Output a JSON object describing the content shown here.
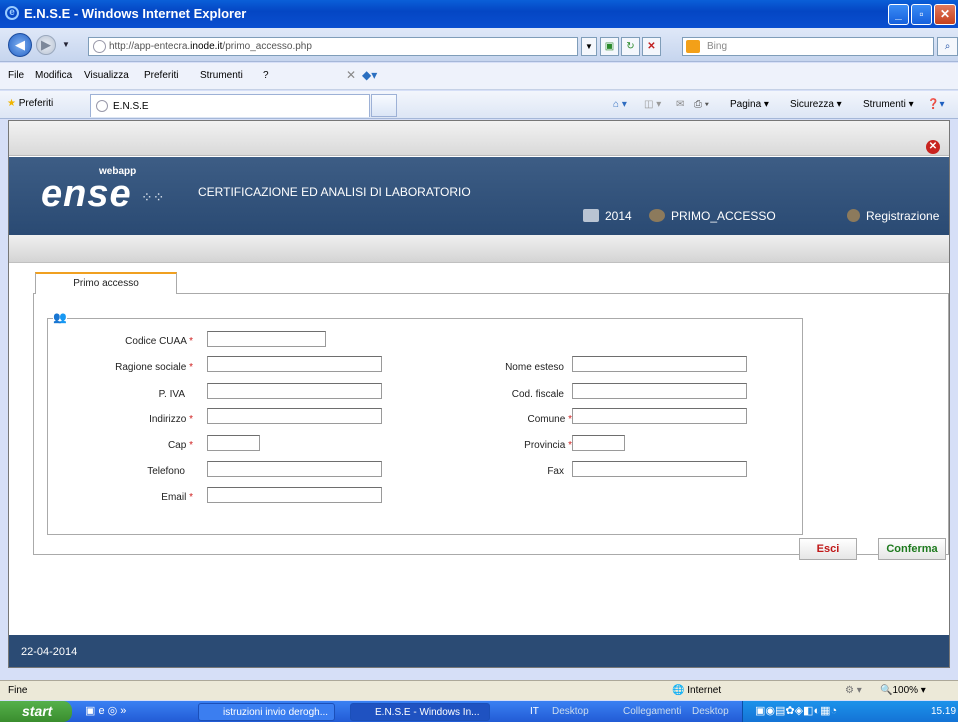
{
  "window": {
    "title": "E.N.S.E - Windows Internet Explorer"
  },
  "address": {
    "url_prefix": "http://app-entecra.",
    "url_host": "inode.it",
    "url_path": "/primo_accesso.php",
    "search_placeholder": "Bing"
  },
  "menu": {
    "items": [
      "File",
      "Modifica",
      "Visualizza",
      "Preferiti",
      "Strumenti",
      "?"
    ]
  },
  "favorites": {
    "label": "Preferiti",
    "tab_title": "E.N.S.E",
    "tools": [
      "Pagina ▾",
      "Sicurezza ▾",
      "Strumenti ▾"
    ]
  },
  "app": {
    "logo_small": "webapp",
    "logo_main": "ense",
    "title": "CERTIFICAZIONE ED ANALISI DI LABORATORIO",
    "year": "2014",
    "user": "PRIMO_ACCESSO",
    "registration": "Registrazione",
    "tab": "Primo accesso",
    "fields": {
      "cuaa": "Codice CUAA",
      "ragione": "Ragione sociale",
      "piva": "P. IVA",
      "indirizzo": "Indirizzo",
      "cap": "Cap",
      "telefono": "Telefono",
      "email": "Email",
      "nome_esteso": "Nome esteso",
      "cod_fiscale": "Cod. fiscale",
      "comune": "Comune",
      "provincia": "Provincia",
      "fax": "Fax"
    },
    "required_mark": "*",
    "buttons": {
      "exit": "Esci",
      "confirm": "Conferma"
    },
    "footer_date": "22-04-2014"
  },
  "status": {
    "left": "Fine",
    "zone": "Internet",
    "zoom": "100%"
  },
  "taskbar": {
    "start": "start",
    "tasks": [
      "istruzioni invio derogh...",
      "E.N.S.E - Windows In..."
    ],
    "lang": "IT",
    "desktop": "Desktop",
    "links": "Collegamenti",
    "desktop2": "Desktop",
    "clock": "15.19"
  },
  "colors": {
    "header": "#2d4d76",
    "required": "#d02020",
    "confirm": "#1e7a1e",
    "exit": "#c01818",
    "tab_accent": "#f0a020"
  }
}
